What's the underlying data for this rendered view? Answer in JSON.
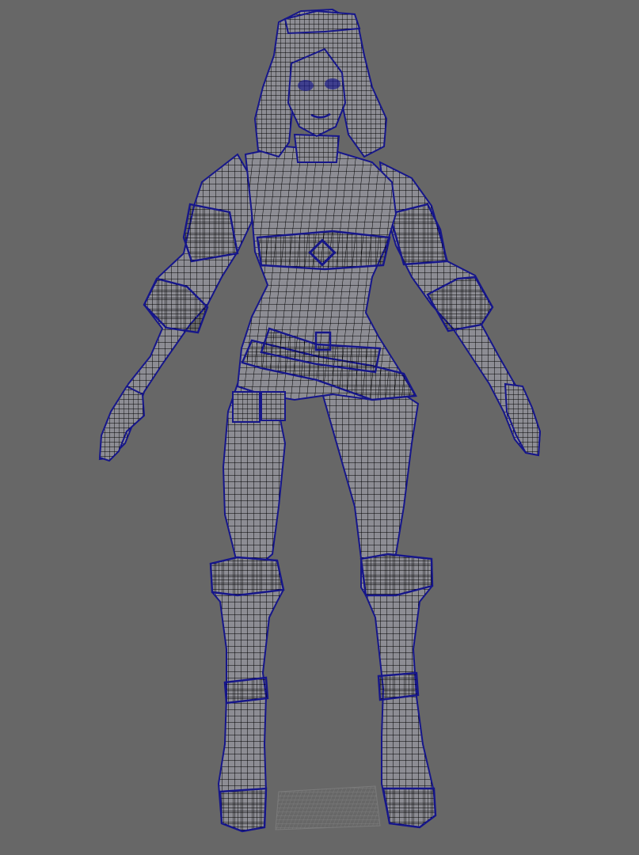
{
  "viewport": {
    "background_color": "#676767",
    "wire_color": "#16168a",
    "shell_color": "#8d8d94",
    "shell_shade_color": "#7c7c85",
    "ground_grid_color": "#7f7f7f"
  },
  "scene": {
    "subject": "female-character-wireframe-mesh",
    "pose": "a-pose",
    "parts": [
      "hair",
      "goggles",
      "face",
      "torso",
      "corset",
      "belt",
      "belt-pouch",
      "left-arm",
      "right-arm",
      "left-hand",
      "right-hand",
      "left-leg",
      "right-leg",
      "left-boot",
      "right-boot"
    ],
    "ground_grid": true
  }
}
